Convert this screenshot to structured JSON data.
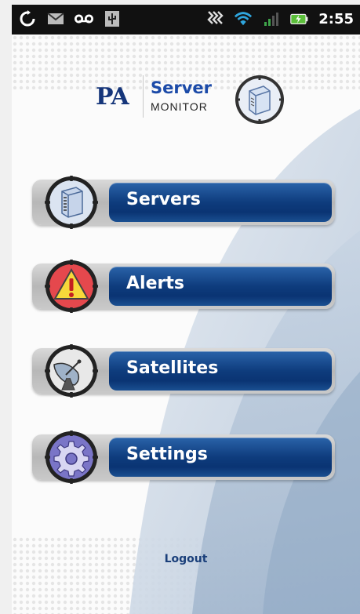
{
  "status_bar": {
    "time": "2:55",
    "left_icons": [
      "sync-icon",
      "gmail-icon",
      "voicemail-icon",
      "usb-icon"
    ],
    "right_icons": [
      "vibrate-icon",
      "wifi-icon",
      "signal-icon",
      "battery-charging-icon"
    ]
  },
  "logo": {
    "pa": "PA",
    "server": "Server",
    "monitor": "MONITOR"
  },
  "menu": [
    {
      "label": "Servers",
      "icon": "server-icon"
    },
    {
      "label": "Alerts",
      "icon": "alert-icon"
    },
    {
      "label": "Satellites",
      "icon": "satellite-dish-icon"
    },
    {
      "label": "Settings",
      "icon": "gear-icon"
    }
  ],
  "footer": {
    "logout": "Logout"
  },
  "colors": {
    "brand_navy": "#15357a",
    "button_blue": "#0e3c7d",
    "status_bar_bg": "#111111"
  }
}
